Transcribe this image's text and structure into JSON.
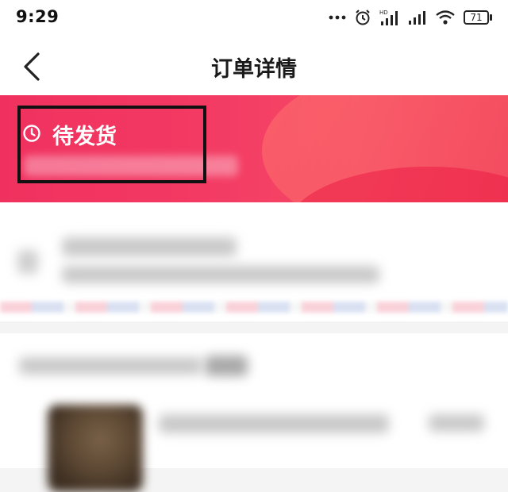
{
  "status_bar": {
    "time": "9:29",
    "battery": "71"
  },
  "nav": {
    "title": "订单详情"
  },
  "order_status": {
    "title": "待发货"
  },
  "colors": {
    "banner": "#f0315f",
    "highlight_border": "#111111"
  }
}
